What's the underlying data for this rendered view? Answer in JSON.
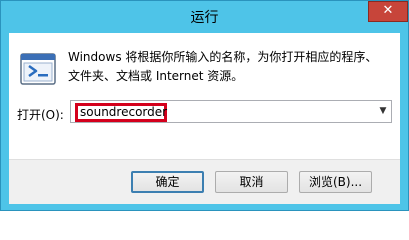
{
  "window": {
    "title": "运行",
    "close_glyph": "✕"
  },
  "dialog": {
    "description": "Windows 将根据你所输入的名称，为你打开相应的程序、文件夹、文档或 Internet 资源。",
    "open_label": "打开(O):",
    "open_value": "soundrecorder",
    "dropdown_icon": "chevron-down-icon"
  },
  "buttons": {
    "ok": "确定",
    "cancel": "取消",
    "browse": "浏览(B)..."
  },
  "colors": {
    "title_bar": "#4ec4e8",
    "close_button": "#c7453a",
    "highlight_box": "#d4001c",
    "default_button_border": "#3c7fb1"
  }
}
